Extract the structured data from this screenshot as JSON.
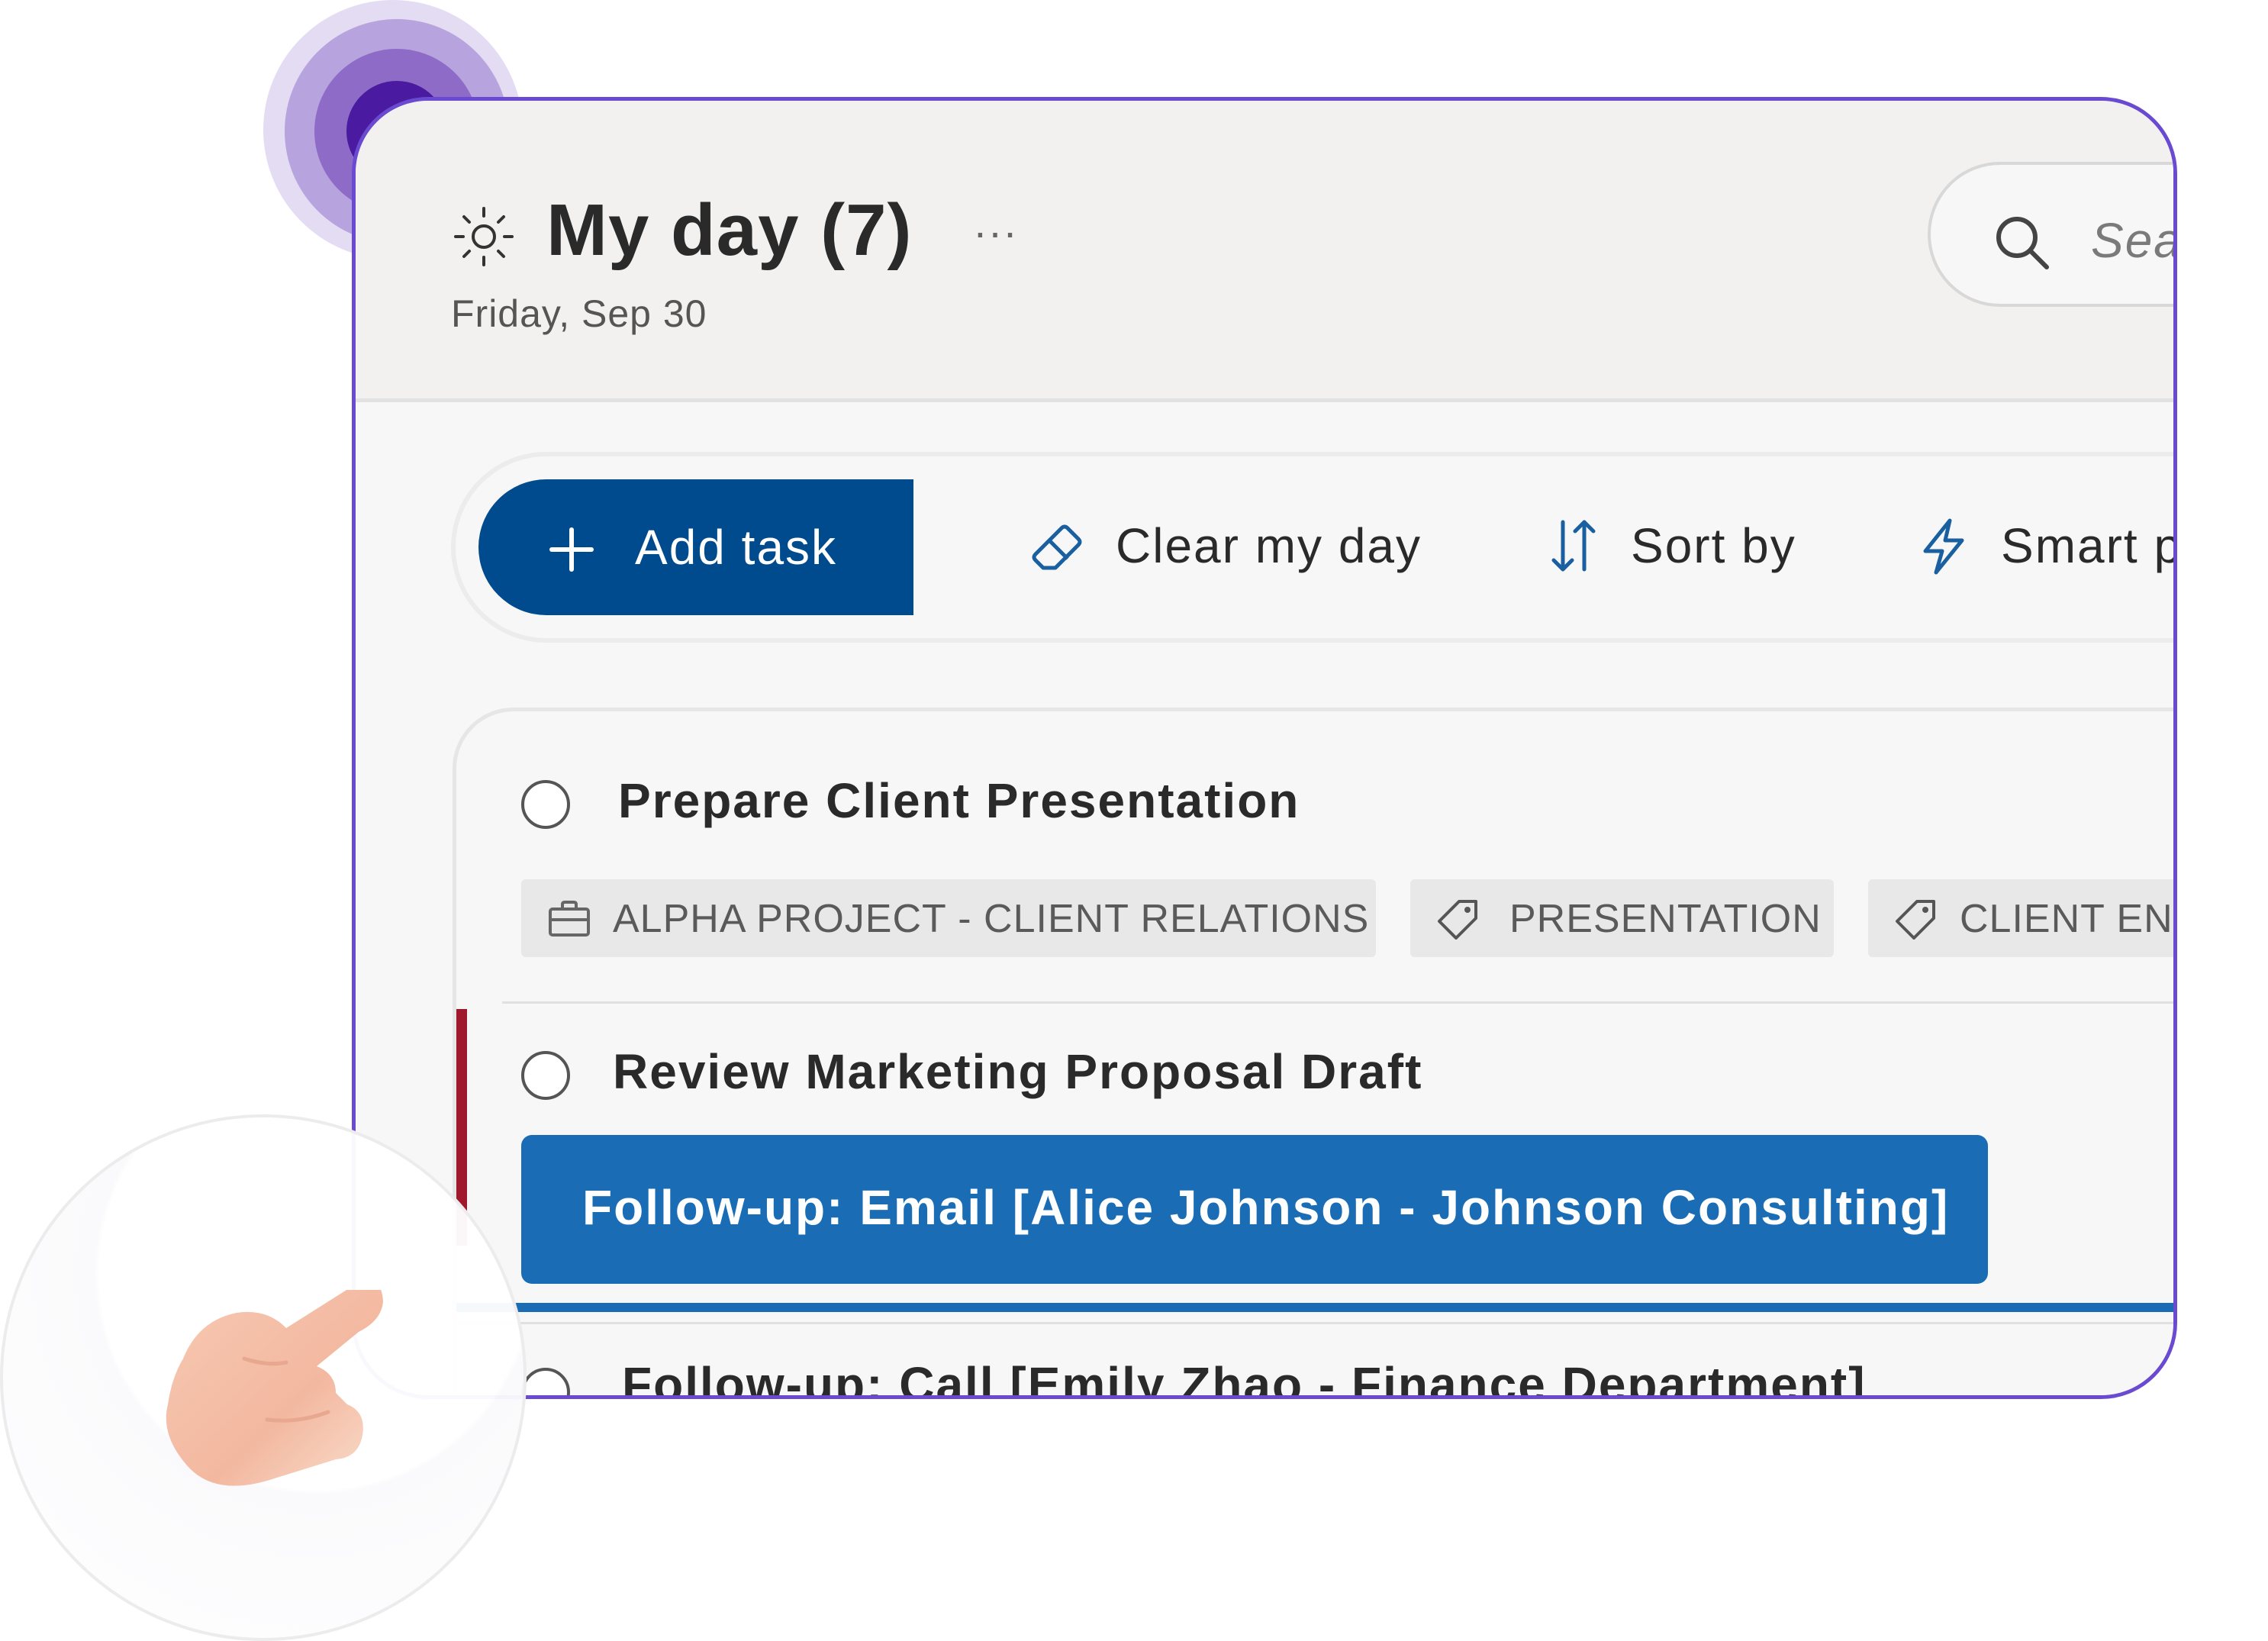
{
  "header": {
    "title": "My day (7)",
    "date": "Friday, Sep 30",
    "more": "...",
    "search_placeholder": "Sear"
  },
  "toolbar": {
    "add_task": "Add task",
    "clear_my_day": "Clear my day",
    "sort_by": "Sort by",
    "smart": "Smart pr"
  },
  "tasks": [
    {
      "title": "Prepare Client Presentation",
      "tags": [
        {
          "icon": "briefcase-icon",
          "label": "ALPHA PROJECT - CLIENT RELATIONS"
        },
        {
          "icon": "tag-icon",
          "label": "PRESENTATION"
        },
        {
          "icon": "tag-icon",
          "label": "CLIENT ENGAG"
        }
      ]
    },
    {
      "title": "Review Marketing Proposal Draft",
      "highlight": "Follow-up: Email [Alice Johnson - Johnson Consulting]"
    },
    {
      "title": "Follow-up: Call [Emily Zhao - Finance Department]"
    }
  ],
  "colors": {
    "accent": "#004b8d",
    "frame": "#6a4ad0",
    "highlight": "#1a6db5",
    "priority": "#a0182e",
    "pulse": "#4a1aa0"
  }
}
